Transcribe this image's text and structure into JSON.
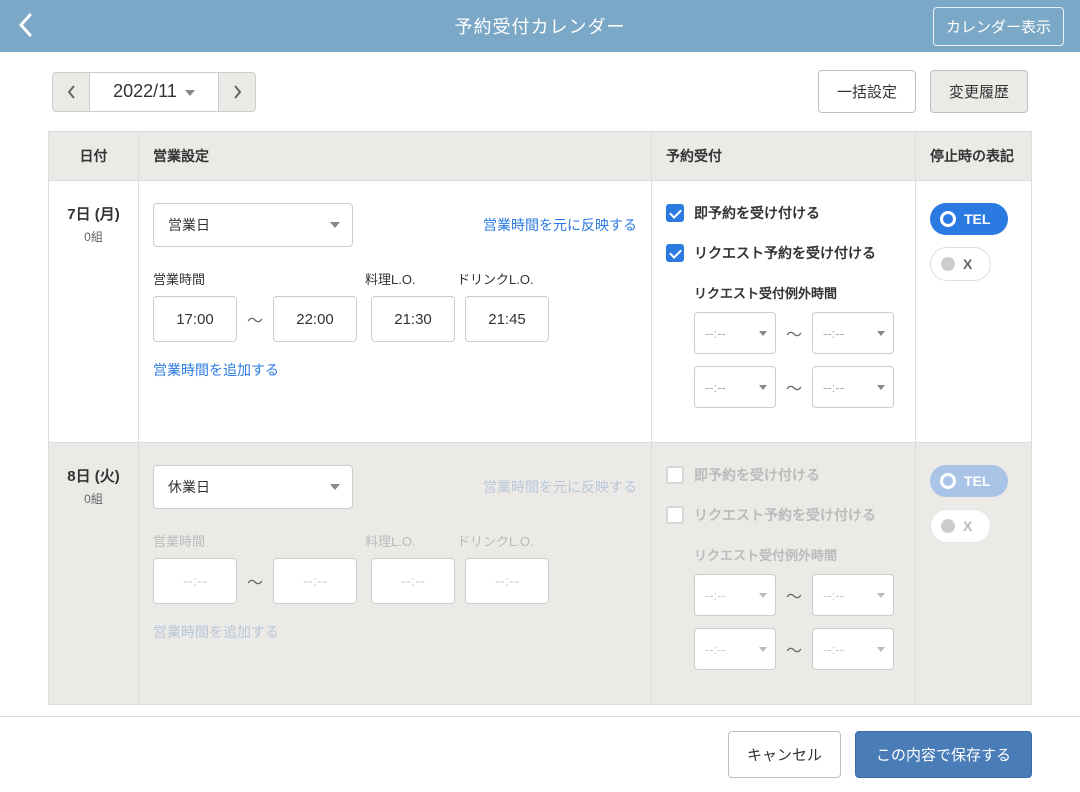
{
  "header": {
    "title": "予約受付カレンダー",
    "calendar_view_btn": "カレンダー表示"
  },
  "toolbar": {
    "month": "2022/11",
    "bulk_btn": "一括設定",
    "history_btn": "変更履歴"
  },
  "columns": {
    "date": "日付",
    "business": "営業設定",
    "accept": "予約受付",
    "stop": "停止時の表記"
  },
  "labels": {
    "open_hours": "営業時間",
    "dish_lo": "料理L.O.",
    "drink_lo": "ドリンクL.O.",
    "reflect_link": "営業時間を元に反映する",
    "add_hours_link": "営業時間を追加する",
    "instant_booking": "即予約を受け付ける",
    "request_booking": "リクエスト予約を受け付ける",
    "request_exception": "リクエスト受付例外時間",
    "tilde": "〜",
    "time_placeholder": "--:--",
    "pill_tel": "TEL",
    "pill_x": "X"
  },
  "rows": [
    {
      "date_main": "7日 (月)",
      "date_sub": "0組",
      "status": "営業日",
      "open_from": "17:00",
      "open_to": "22:00",
      "dish_lo": "21:30",
      "drink_lo": "21:45",
      "instant_checked": true,
      "request_checked": true,
      "req_ex": [
        {
          "from": "--:--",
          "to": "--:--"
        },
        {
          "from": "--:--",
          "to": "--:--"
        }
      ],
      "stop_sel": "TEL",
      "disabled": false
    },
    {
      "date_main": "8日 (火)",
      "date_sub": "0組",
      "status": "休業日",
      "open_from": "--:--",
      "open_to": "--:--",
      "dish_lo": "--:--",
      "drink_lo": "--:--",
      "instant_checked": false,
      "request_checked": false,
      "req_ex": [
        {
          "from": "--:--",
          "to": "--:--"
        },
        {
          "from": "--:--",
          "to": "--:--"
        }
      ],
      "stop_sel": "TEL",
      "disabled": true
    }
  ],
  "footer": {
    "cancel": "キャンセル",
    "save": "この内容で保存する"
  }
}
